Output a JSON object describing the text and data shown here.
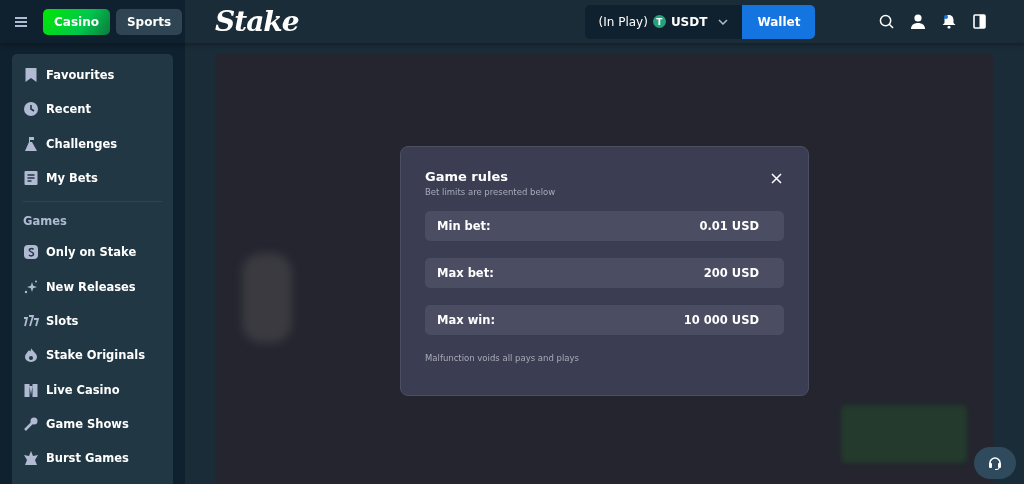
{
  "header": {
    "tabs": [
      {
        "label": "Casino",
        "selected": true
      },
      {
        "label": "Sports",
        "selected": false
      }
    ],
    "logo": "Stake",
    "balance": {
      "label": "(In Play)",
      "currency_badge": "T",
      "currency": "USDT"
    },
    "wallet_button": "Wallet"
  },
  "sidebar": {
    "items": [
      {
        "kind": "item",
        "label": "Favourites"
      },
      {
        "kind": "item",
        "label": "Recent"
      },
      {
        "kind": "item",
        "label": "Challenges"
      },
      {
        "kind": "item",
        "label": "My Bets"
      },
      {
        "kind": "divider"
      },
      {
        "kind": "heading",
        "label": "Games"
      },
      {
        "kind": "item",
        "label": "Only on Stake"
      },
      {
        "kind": "item",
        "label": "New Releases"
      },
      {
        "kind": "item",
        "label": "Slots"
      },
      {
        "kind": "item",
        "label": "Stake Originals"
      },
      {
        "kind": "item",
        "label": "Live Casino"
      },
      {
        "kind": "item",
        "label": "Game Shows"
      },
      {
        "kind": "item",
        "label": "Burst Games"
      }
    ]
  },
  "modal": {
    "title": "Game rules",
    "subtitle": "Bet limits are presented below",
    "limits": [
      {
        "label": "Min bet:",
        "value": "0.01 USD"
      },
      {
        "label": "Max bet:",
        "value": "200 USD"
      },
      {
        "label": "Max win:",
        "value": "10 000 USD"
      }
    ],
    "footnote": "Malfunction voids all pays and plays"
  }
}
